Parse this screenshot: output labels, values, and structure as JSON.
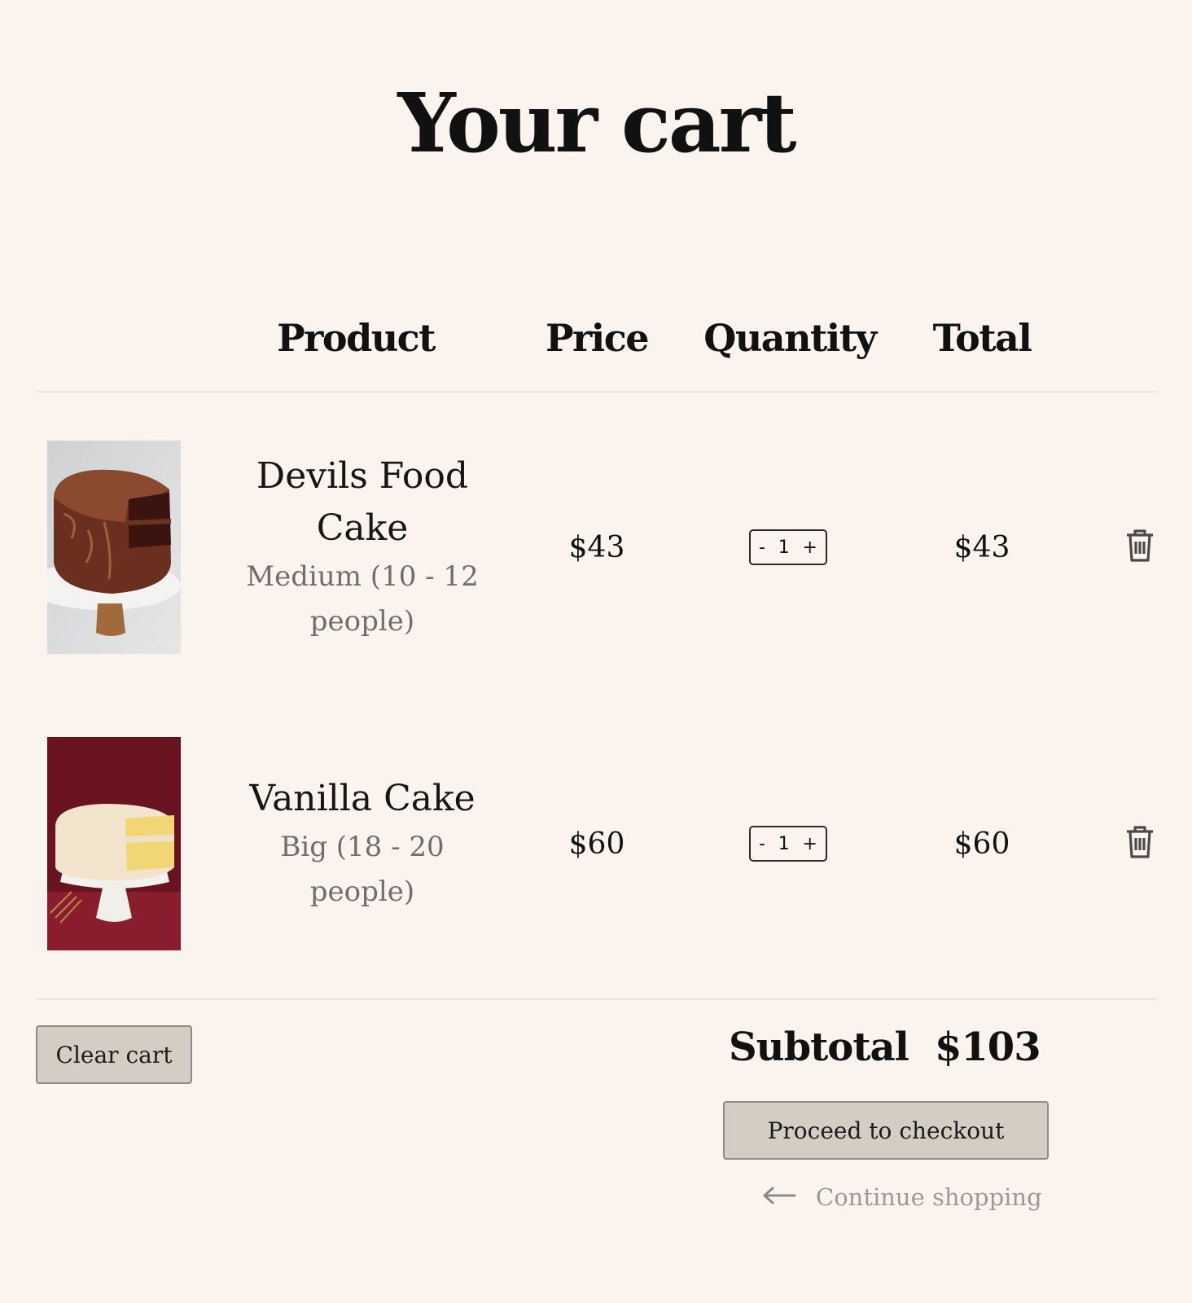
{
  "page": {
    "title": "Your cart"
  },
  "columns": {
    "product": "Product",
    "price": "Price",
    "quantity": "Quantity",
    "total": "Total"
  },
  "items": [
    {
      "name": "Devils Food Cake",
      "size": "Medium (10 - 12 people)",
      "price": "$43",
      "quantity": "1",
      "total": "$43",
      "image": "chocolate-cake-image"
    },
    {
      "name": "Vanilla Cake",
      "size": "Big (18 - 20 people)",
      "price": "$60",
      "quantity": "1",
      "total": "$60",
      "image": "vanilla-cake-image"
    }
  ],
  "stepper": {
    "minus": "-",
    "plus": "+"
  },
  "actions": {
    "clear_cart": "Clear cart",
    "checkout": "Proceed to checkout",
    "continue_shopping": "Continue shopping"
  },
  "summary": {
    "subtotal_label": "Subtotal",
    "subtotal_value": "$103"
  },
  "icons": {
    "delete": "trash-icon",
    "back": "arrow-left-icon"
  },
  "colors": {
    "background": "#fbf4ee",
    "button": "#d3cdc4",
    "muted_text": "#6e6e6e"
  }
}
